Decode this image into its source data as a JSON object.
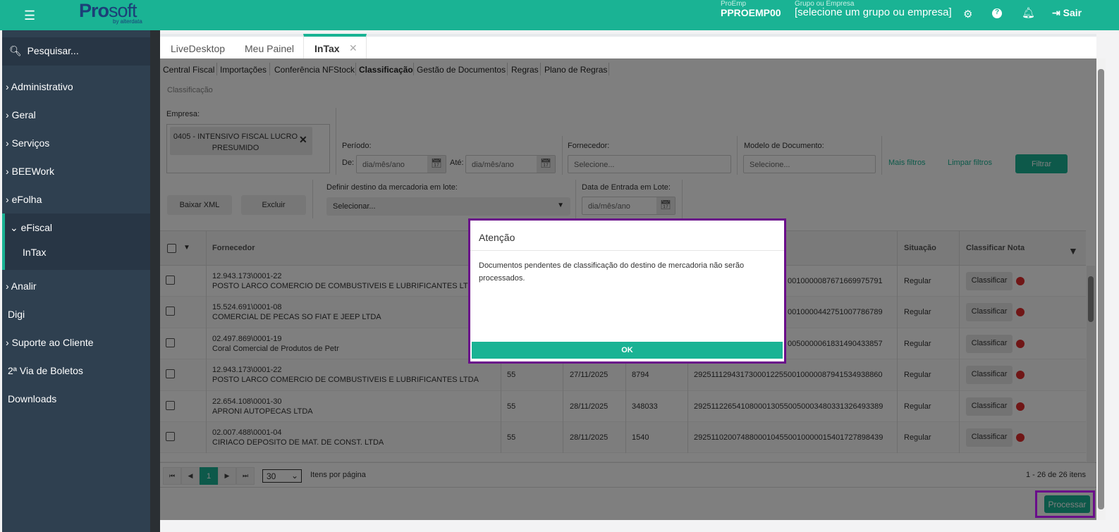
{
  "header": {
    "logo": "Prosoft",
    "logo_sub": "by alterdata",
    "proemp_label": "ProEmp",
    "proemp_value": "PPROEMP00",
    "grupo_label": "Grupo ou Empresa",
    "grupo_value": "[selecione um grupo ou empresa]",
    "sair": "Sair"
  },
  "sidebar": {
    "search_placeholder": "Pesquisar...",
    "items": [
      {
        "label": "Administrativo"
      },
      {
        "label": "Geral"
      },
      {
        "label": "Serviços"
      },
      {
        "label": "BEEWork"
      },
      {
        "label": "eFolha"
      },
      {
        "label": "eFiscal"
      },
      {
        "label": "InTax"
      },
      {
        "label": "Analir"
      },
      {
        "label": "Digi"
      },
      {
        "label": "Suporte ao Cliente"
      },
      {
        "label": "2ª Via de Boletos"
      },
      {
        "label": "Downloads"
      }
    ]
  },
  "tabs": [
    {
      "label": "LiveDesktop"
    },
    {
      "label": "Meu Painel"
    },
    {
      "label": "InTax"
    }
  ],
  "subnav": [
    "Central Fiscal",
    "Importações",
    "Conferência NFStock",
    "Classificação",
    "Gestão de Documentos",
    "Regras",
    "Plano de Regras"
  ],
  "breadcrumb": "Classificação",
  "filters": {
    "empresa_label": "Empresa:",
    "empresa_value": "0405 - INTENSIVO FISCAL LUCRO PRESUMIDO",
    "periodo_label": "Período:",
    "de_label": "De:",
    "ate_label": "Até:",
    "date_placeholder": "dia/mês/ano",
    "fornecedor_label": "Fornecedor:",
    "fornecedor_placeholder": "Selecione...",
    "modelo_label": "Modelo de Documento:",
    "modelo_placeholder": "Selecione...",
    "mais_filtros": "Mais filtros",
    "limpar_filtros": "Limpar filtros",
    "filtrar": "Filtrar",
    "baixar_xml": "Baixar XML",
    "excluir": "Excluir",
    "destino_label": "Definir destino da mercadoria em lote:",
    "destino_value": "Selecionar...",
    "data_entrada_label": "Data de Entrada em Lote:"
  },
  "table": {
    "headers": {
      "fornecedor": "Fornecedor",
      "situacao": "Situação",
      "classificar": "Classificar Nota"
    },
    "action_label": "Classificar",
    "rows": [
      {
        "cnpj": "12.943.173\\0001-22",
        "nome": "POSTO LARCO COMERCIO DE COMBUSTIVEIS E LUBRIFICANTES LTDA",
        "modelo": "",
        "data": "",
        "numero": "",
        "chave": "0010000087671669975791",
        "situacao": "Regular"
      },
      {
        "cnpj": "15.524.691\\0001-08",
        "nome": "COMERCIAL DE PECAS SO FIAT E JEEP LTDA",
        "modelo": "",
        "data": "",
        "numero": "",
        "chave": "0010000442751007786789",
        "situacao": "Regular"
      },
      {
        "cnpj": "02.497.869\\0001-19",
        "nome": "Coral Comercial de Produtos de Petr",
        "modelo": "",
        "data": "",
        "numero": "",
        "chave": "0050000061831490433857",
        "situacao": "Regular"
      },
      {
        "cnpj": "12.943.173\\0001-22",
        "nome": "POSTO LARCO COMERCIO DE COMBUSTIVEIS E LUBRIFICANTES LTDA",
        "modelo": "55",
        "data": "27/11/2025",
        "numero": "8794",
        "chave": "29251112943173000122550010000087941534938860",
        "situacao": "Regular"
      },
      {
        "cnpj": "22.654.108\\0001-30",
        "nome": "APRONI AUTOPECAS LTDA",
        "modelo": "55",
        "data": "28/11/2025",
        "numero": "348033",
        "chave": "29251122654108000130550050003480331326493389",
        "situacao": "Regular"
      },
      {
        "cnpj": "02.007.488\\0001-04",
        "nome": "CIRIACO DEPOSITO DE MAT. DE CONST. LTDA",
        "modelo": "55",
        "data": "28/11/2025",
        "numero": "1540",
        "chave": "29251102007488000104550010000015401727898439",
        "situacao": "Regular"
      }
    ]
  },
  "pager": {
    "page": "1",
    "per_page": "30",
    "per_page_label": "Itens por página",
    "summary": "1 - 26 de 26 itens"
  },
  "modal": {
    "title": "Atenção",
    "body": "Documentos pendentes de classificação do destino de mercadoria não serão processados.",
    "ok": "OK"
  },
  "footer": {
    "processar": "Processar"
  }
}
